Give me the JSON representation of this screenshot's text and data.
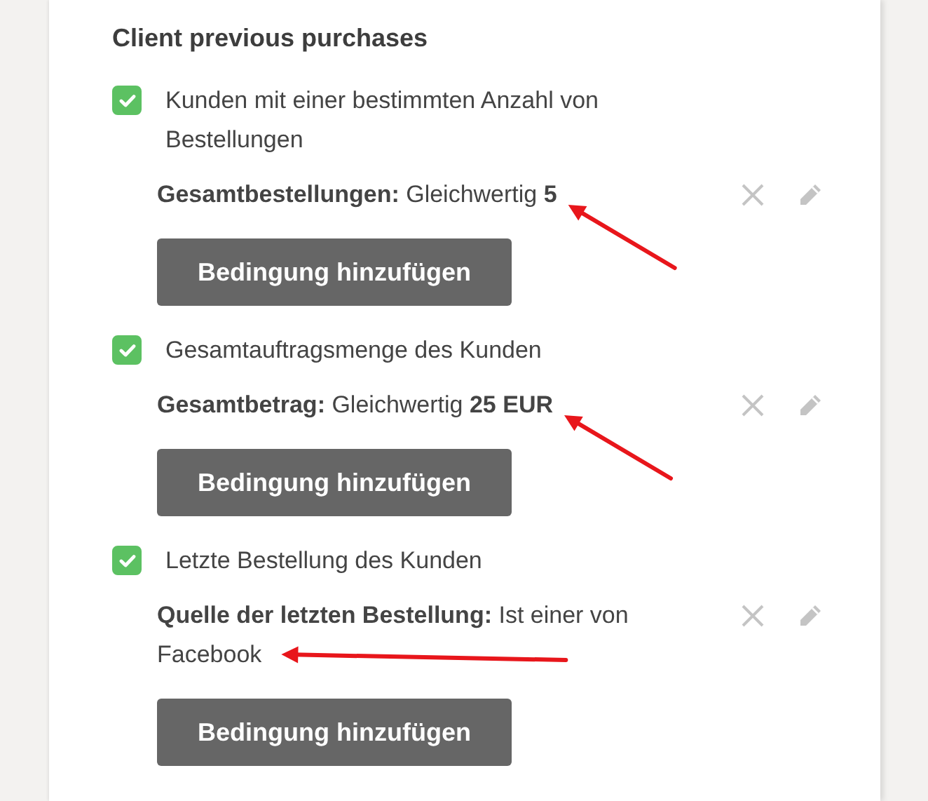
{
  "section": {
    "title": "Client previous purchases"
  },
  "rules": [
    {
      "label": "Kunden mit einer bestimmten Anzahl von Bestellungen",
      "checked": true,
      "condition": {
        "field": "Gesamtbestellungen:",
        "operator": "Gleichwertig",
        "value": "5",
        "value_bold": true,
        "highlighted": true
      },
      "button": "Bedingung hinzufügen"
    },
    {
      "label": "Gesamtauftragsmenge des Kunden",
      "checked": true,
      "condition": {
        "field": "Gesamtbetrag:",
        "operator": "Gleichwertig",
        "value": "25 EUR",
        "value_bold": true,
        "highlighted": true
      },
      "button": "Bedingung hinzufügen"
    },
    {
      "label": "Letzte Bestellung des Kunden",
      "checked": true,
      "condition": {
        "field": "Quelle der letzten Bestellung:",
        "operator": "Ist einer von",
        "value": "Facebook",
        "value_bold": false,
        "highlighted": true
      },
      "button": "Bedingung hinzufügen"
    }
  ]
}
